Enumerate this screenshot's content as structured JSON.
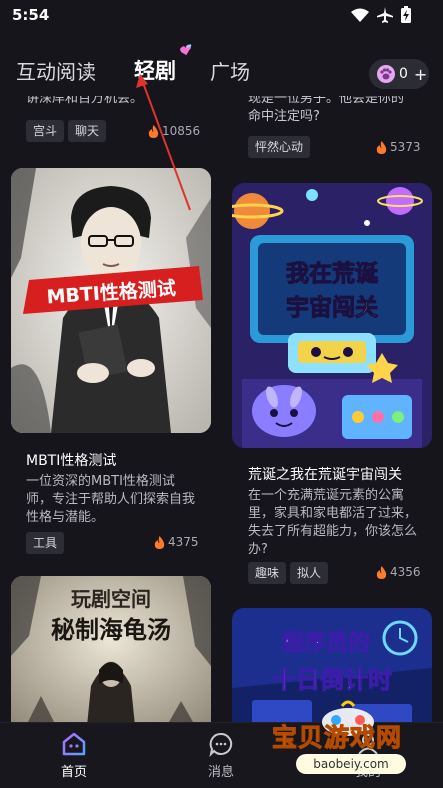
{
  "status_bar": {
    "time": "5:54"
  },
  "top_tabs": [
    {
      "label": "互动阅读"
    },
    {
      "label": "轻剧"
    },
    {
      "label": "广场"
    }
  ],
  "coins": {
    "count": "0",
    "plus": "+"
  },
  "feed": {
    "partial_left": {
      "text": "讲深岸和百万机会。",
      "tags": [
        "宫斗",
        "聊天"
      ],
      "heat": "10856"
    },
    "partial_right": {
      "text_line1": "现是一位男子。他会是你的",
      "text_line2": "命中注定吗?",
      "tags": [
        "怦然心动"
      ],
      "heat": "5373"
    },
    "cards": [
      {
        "title": "MBTI性格测试",
        "cover_text": "MBTI性格测试",
        "desc": "一位资深的MBTI性格测试师，专注于帮助人们探索自我性格与潜能。",
        "tags": [
          "工具"
        ],
        "heat": "4375"
      },
      {
        "title": "荒诞之我在荒诞宇宙闯关",
        "cover_text_1": "我在荒诞",
        "cover_text_2": "宇宙闯关",
        "desc": "在一个充满荒诞元素的公寓里，家具和家电都活了过来，失去了所有超能力，你该怎么办?",
        "tags": [
          "趣味",
          "拟人"
        ],
        "heat": "4356"
      },
      {
        "cover_text_1": "玩剧空间",
        "cover_text_2": "秘制海龟汤"
      },
      {
        "cover_text_1": "程序员的",
        "cover_text_2": "十日倒计时"
      }
    ]
  },
  "bottom_nav": [
    {
      "label": "首页"
    },
    {
      "label": "消息"
    },
    {
      "label": "我的"
    }
  ],
  "watermark": {
    "text": "宝贝游戏网",
    "url": "baobeiy.com"
  }
}
